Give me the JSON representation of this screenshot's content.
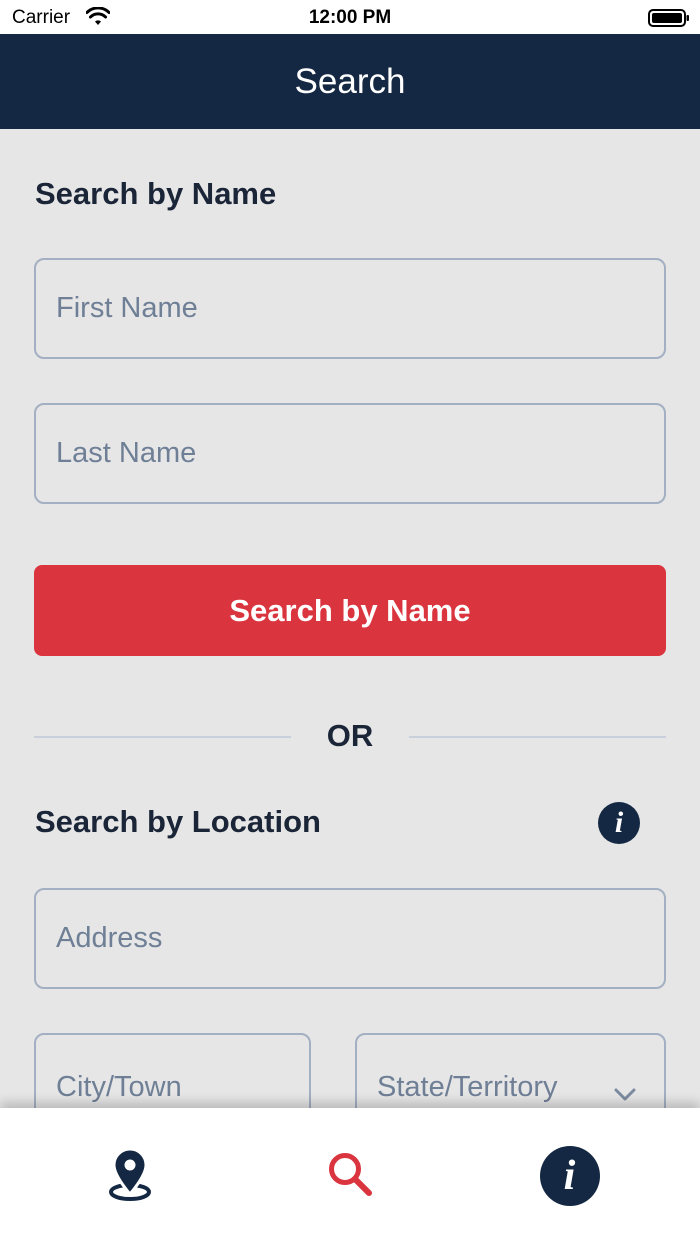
{
  "status_bar": {
    "carrier": "Carrier",
    "time": "12:00 PM"
  },
  "nav": {
    "title": "Search"
  },
  "name_section": {
    "title": "Search by Name",
    "first_name_placeholder": "First Name",
    "last_name_placeholder": "Last Name",
    "button_label": "Search by Name"
  },
  "divider": {
    "label": "OR"
  },
  "location_section": {
    "title": "Search by Location",
    "info_icon": "i",
    "address_placeholder": "Address",
    "city_placeholder": "City/Town",
    "state_placeholder": "State/Territory"
  },
  "tab_bar": {
    "tabs": [
      {
        "icon": "map-pin-icon",
        "active": false
      },
      {
        "icon": "search-icon",
        "active": true
      },
      {
        "icon": "info-icon",
        "active": false,
        "glyph": "i"
      }
    ]
  },
  "colors": {
    "nav": "#142843",
    "accent": "#da343e",
    "background": "#e6e6e6"
  }
}
